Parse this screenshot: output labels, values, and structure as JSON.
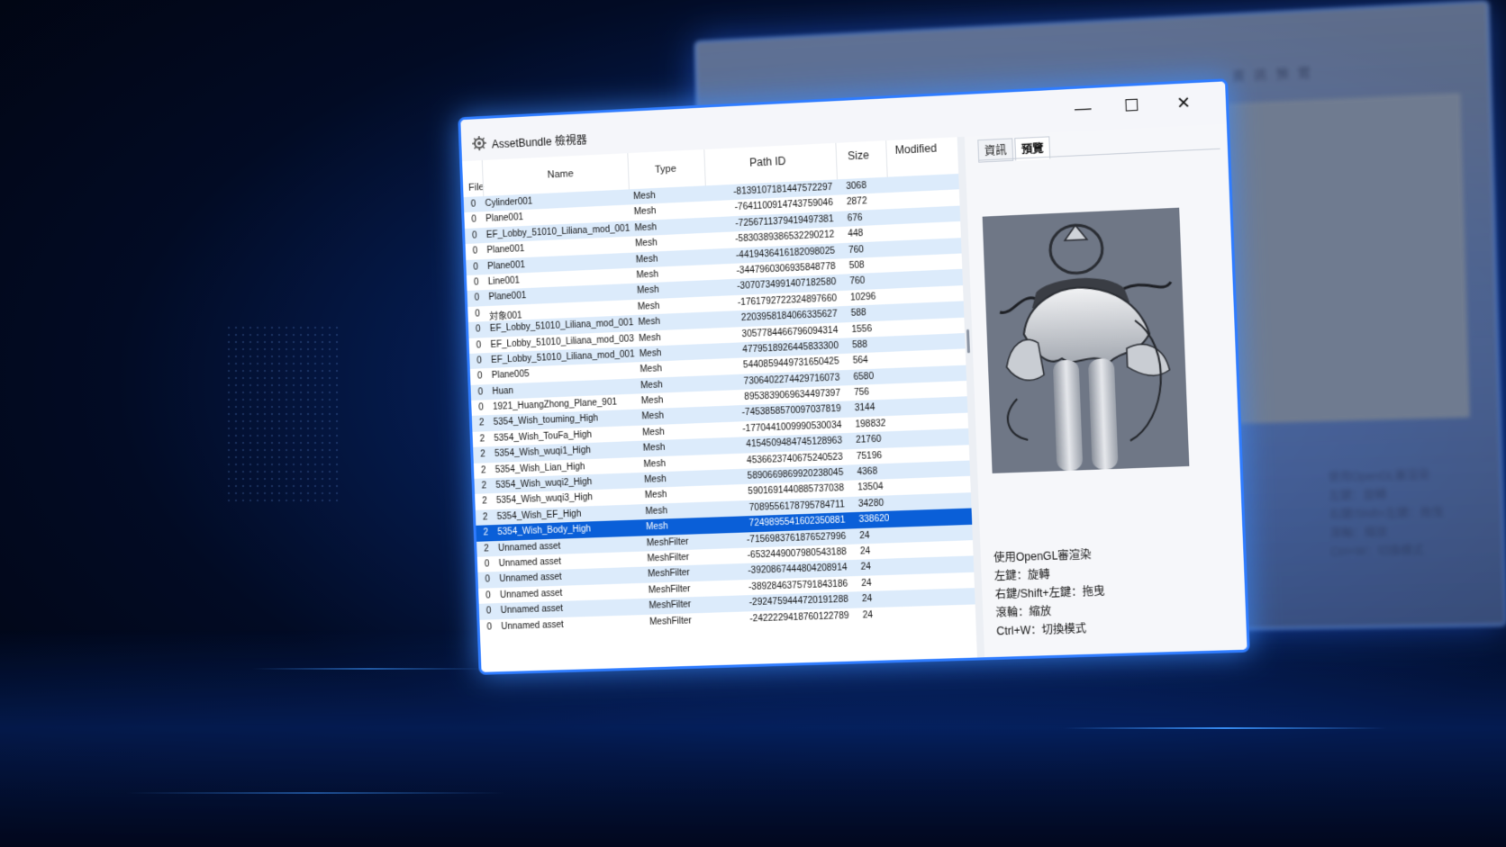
{
  "window": {
    "title": "AssetBundle 檢視器",
    "minimize_glyph": "—",
    "maximize_glyph": "☐",
    "close_glyph": "✕"
  },
  "columns": {
    "file": "File",
    "name": "Name",
    "type": "Type",
    "path_id": "Path ID",
    "size": "Size",
    "modified": "Modified"
  },
  "rows": [
    {
      "file": "0",
      "name": "Cylinder001",
      "type": "Mesh",
      "path_id": "-8139107181447572297",
      "size": "3068"
    },
    {
      "file": "0",
      "name": "Plane001",
      "type": "Mesh",
      "path_id": "-7641100914743759046",
      "size": "2872"
    },
    {
      "file": "0",
      "name": "EF_Lobby_51010_Liliana_mod_001",
      "type": "Mesh",
      "path_id": "-7256711379419497381",
      "size": "676"
    },
    {
      "file": "0",
      "name": "Plane001",
      "type": "Mesh",
      "path_id": "-5830389386532290212",
      "size": "448"
    },
    {
      "file": "0",
      "name": "Plane001",
      "type": "Mesh",
      "path_id": "-4419436416182098025",
      "size": "760"
    },
    {
      "file": "0",
      "name": "Line001",
      "type": "Mesh",
      "path_id": "-3447960306935848778",
      "size": "508"
    },
    {
      "file": "0",
      "name": "Plane001",
      "type": "Mesh",
      "path_id": "-3070734991407182580",
      "size": "760"
    },
    {
      "file": "0",
      "name": "対象001",
      "type": "Mesh",
      "path_id": "-1761792722324897660",
      "size": "10296"
    },
    {
      "file": "0",
      "name": "EF_Lobby_51010_Liliana_mod_001",
      "type": "Mesh",
      "path_id": "2203958184066335627",
      "size": "588"
    },
    {
      "file": "0",
      "name": "EF_Lobby_51010_Liliana_mod_003",
      "type": "Mesh",
      "path_id": "3057784466796094314",
      "size": "1556"
    },
    {
      "file": "0",
      "name": "EF_Lobby_51010_Liliana_mod_001",
      "type": "Mesh",
      "path_id": "4779518926445833300",
      "size": "588"
    },
    {
      "file": "0",
      "name": "Plane005",
      "type": "Mesh",
      "path_id": "5440859449731650425",
      "size": "564"
    },
    {
      "file": "0",
      "name": "Huan",
      "type": "Mesh",
      "path_id": "7306402274429716073",
      "size": "6580"
    },
    {
      "file": "0",
      "name": "1921_HuangZhong_Plane_901",
      "type": "Mesh",
      "path_id": "8953839069634497397",
      "size": "756"
    },
    {
      "file": "2",
      "name": "5354_Wish_touming_High",
      "type": "Mesh",
      "path_id": "-7453858570097037819",
      "size": "3144"
    },
    {
      "file": "2",
      "name": "5354_Wish_TouFa_High",
      "type": "Mesh",
      "path_id": "-1770441009990530034",
      "size": "198832"
    },
    {
      "file": "2",
      "name": "5354_Wish_wuqi1_High",
      "type": "Mesh",
      "path_id": "4154509484745128963",
      "size": "21760"
    },
    {
      "file": "2",
      "name": "5354_Wish_Lian_High",
      "type": "Mesh",
      "path_id": "4536623740675240523",
      "size": "75196"
    },
    {
      "file": "2",
      "name": "5354_Wish_wuqi2_High",
      "type": "Mesh",
      "path_id": "5890669869920238045",
      "size": "4368"
    },
    {
      "file": "2",
      "name": "5354_Wish_wuqi3_High",
      "type": "Mesh",
      "path_id": "5901691440885737038",
      "size": "13504"
    },
    {
      "file": "2",
      "name": "5354_Wish_EF_High",
      "type": "Mesh",
      "path_id": "7089556178795784711",
      "size": "34280"
    },
    {
      "file": "2",
      "name": "5354_Wish_Body_High",
      "type": "Mesh",
      "path_id": "7249895541602350881",
      "size": "338620",
      "selected": true
    },
    {
      "file": "2",
      "name": "Unnamed asset",
      "type": "MeshFilter",
      "path_id": "-7156983761876527996",
      "size": "24"
    },
    {
      "file": "0",
      "name": "Unnamed asset",
      "type": "MeshFilter",
      "path_id": "-6532449007980543188",
      "size": "24"
    },
    {
      "file": "0",
      "name": "Unnamed asset",
      "type": "MeshFilter",
      "path_id": "-3920867444804208914",
      "size": "24"
    },
    {
      "file": "0",
      "name": "Unnamed asset",
      "type": "MeshFilter",
      "path_id": "-3892846375791843186",
      "size": "24"
    },
    {
      "file": "0",
      "name": "Unnamed asset",
      "type": "MeshFilter",
      "path_id": "-2924759444720191288",
      "size": "24"
    },
    {
      "file": "0",
      "name": "Unnamed asset",
      "type": "MeshFilter",
      "path_id": "-2422229418760122789",
      "size": "24"
    }
  ],
  "side": {
    "tabs": [
      "資訊",
      "預覽"
    ],
    "active_tab": "預覽",
    "help": [
      "使用OpenGL審渲染",
      "左鍵：旋轉",
      "右鍵/Shift+左鍵：拖曳",
      "滾輪：縮放",
      "Ctrl+W：切換模式"
    ]
  },
  "colors": {
    "accent": "#2f7cff",
    "selected_row": "#0a5fd8",
    "alt_row": "#dcebfb",
    "preview_bg": "#6f7786"
  },
  "icons": {
    "app": "app-gear-icon",
    "preview_model": "3d-model-render"
  }
}
